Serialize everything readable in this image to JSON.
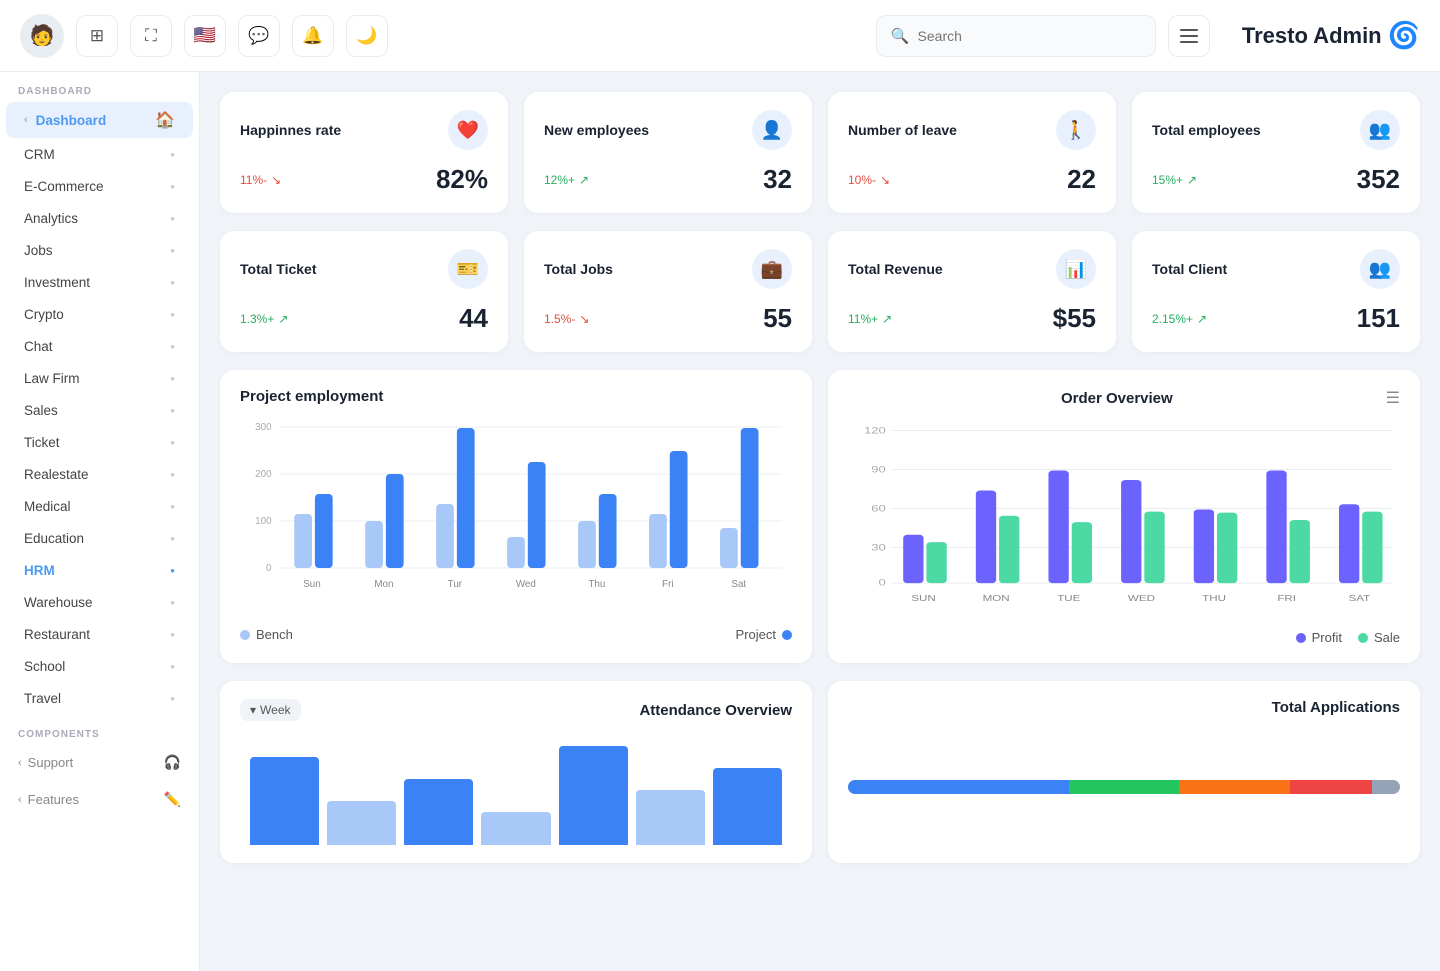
{
  "brand": {
    "name": "Tresto Admin",
    "logo_symbol": "🌀"
  },
  "navbar": {
    "search_placeholder": "Search",
    "icons": [
      "sliders",
      "expand",
      "flag",
      "chat",
      "bell",
      "moon"
    ]
  },
  "sidebar": {
    "dashboard_label": "DASHBOARD",
    "components_label": "COMPONENTS",
    "active_item": "Dashboard",
    "items": [
      {
        "label": "Dashboard",
        "active": true,
        "icon": "🏠"
      },
      {
        "label": "CRM",
        "active": false
      },
      {
        "label": "E-Commerce",
        "active": false
      },
      {
        "label": "Analytics",
        "active": false
      },
      {
        "label": "Jobs",
        "active": false
      },
      {
        "label": "Investment",
        "active": false
      },
      {
        "label": "Crypto",
        "active": false
      },
      {
        "label": "Chat",
        "active": false
      },
      {
        "label": "Law Firm",
        "active": false
      },
      {
        "label": "Sales",
        "active": false
      },
      {
        "label": "Ticket",
        "active": false
      },
      {
        "label": "Realestate",
        "active": false
      },
      {
        "label": "Medical",
        "active": false
      },
      {
        "label": "Education",
        "active": false
      },
      {
        "label": "HRM",
        "active": false,
        "highlighted": true
      },
      {
        "label": "Warehouse",
        "active": false
      },
      {
        "label": "Restaurant",
        "active": false
      },
      {
        "label": "School",
        "active": false
      },
      {
        "label": "Travel",
        "active": false
      }
    ],
    "component_items": [
      {
        "label": "Support"
      },
      {
        "label": "Features"
      }
    ]
  },
  "stats": [
    {
      "title": "Happinnes rate",
      "icon": "❤️",
      "change": "11%-",
      "change_dir": "down",
      "value": "82%"
    },
    {
      "title": "New employees",
      "icon": "👤",
      "change": "12%+",
      "change_dir": "up",
      "value": "32"
    },
    {
      "title": "Number of leave",
      "icon": "🚶",
      "change": "10%-",
      "change_dir": "down",
      "value": "22"
    },
    {
      "title": "Total employees",
      "icon": "👥",
      "change": "15%+",
      "change_dir": "up",
      "value": "352"
    },
    {
      "title": "Total Ticket",
      "icon": "🎫",
      "change": "1.3%+",
      "change_dir": "up",
      "value": "44"
    },
    {
      "title": "Total Jobs",
      "icon": "💼",
      "change": "1.5%-",
      "change_dir": "down",
      "value": "55"
    },
    {
      "title": "Total Revenue",
      "icon": "📊",
      "change": "11%+",
      "change_dir": "up",
      "value": "$55"
    },
    {
      "title": "Total Client",
      "icon": "👥",
      "change": "2.15%+",
      "change_dir": "up",
      "value": "151"
    }
  ],
  "project_employment_chart": {
    "title": "Project employment",
    "days": [
      "Sun",
      "Mon",
      "Tur",
      "Wed",
      "Thu",
      "Fri",
      "Sat"
    ],
    "bench_data": [
      100,
      90,
      130,
      60,
      90,
      100,
      80
    ],
    "project_data": [
      120,
      180,
      265,
      210,
      140,
      225,
      305
    ],
    "y_labels": [
      "0",
      "100",
      "200",
      "300"
    ],
    "legend_bench": "Bench",
    "legend_project": "Project",
    "bench_color": "#a8c8f8",
    "project_color": "#3b82f6"
  },
  "order_overview_chart": {
    "title": "Order Overview",
    "days": [
      "SUN",
      "MON",
      "TUE",
      "WED",
      "THU",
      "FRI",
      "SAT"
    ],
    "profit_data": [
      40,
      75,
      92,
      85,
      60,
      92,
      65
    ],
    "sale_data": [
      35,
      55,
      50,
      60,
      58,
      52,
      60
    ],
    "y_labels": [
      "0",
      "30",
      "60",
      "90",
      "120"
    ],
    "profit_color": "#6c63ff",
    "sale_color": "#4cd9a4",
    "legend_profit": "Profit",
    "legend_sale": "Sale"
  },
  "attendance_overview": {
    "title": "Attendance Overview",
    "week_label": "Week"
  },
  "total_applications": {
    "title": "Total Applications",
    "segments": [
      {
        "label": "Blue",
        "color": "#3b82f6",
        "pct": 40
      },
      {
        "label": "Green",
        "color": "#22c55e",
        "pct": 20
      },
      {
        "label": "Orange",
        "color": "#f97316",
        "pct": 20
      },
      {
        "label": "Red",
        "color": "#ef4444",
        "pct": 15
      },
      {
        "label": "Gray",
        "color": "#94a3b8",
        "pct": 5
      }
    ]
  }
}
